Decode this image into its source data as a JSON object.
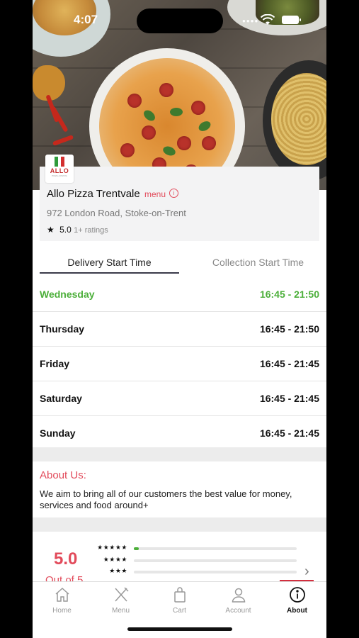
{
  "status_bar": {
    "time": "4:07"
  },
  "restaurant": {
    "logo_text": "ALLO",
    "logo_sub": "PIZZA & PASTA",
    "name": "Allo Pizza Trentvale",
    "menu_link": "menu",
    "info_glyph": "i",
    "address": "972 London Road, Stoke-on-Trent",
    "rating_star": "★",
    "rating": "5.0",
    "ratings_count": "1+ ratings"
  },
  "tabs": [
    {
      "label": "Delivery Start Time",
      "active": true
    },
    {
      "label": "Collection Start Time",
      "active": false
    }
  ],
  "hours": [
    {
      "day": "Wednesday",
      "time": "16:45 - 21:50",
      "today": true
    },
    {
      "day": "Thursday",
      "time": "16:45 - 21:50",
      "today": false
    },
    {
      "day": "Friday",
      "time": "16:45 - 21:45",
      "today": false
    },
    {
      "day": "Saturday",
      "time": "16:45 - 21:45",
      "today": false
    },
    {
      "day": "Sunday",
      "time": "16:45 - 21:45",
      "today": false
    }
  ],
  "about": {
    "title": "About Us:",
    "text": "We aim to bring all of our customers the best value for money, services and food around+"
  },
  "reviews": {
    "score": "5.0",
    "out_of": "Out of 5",
    "rows": [
      {
        "stars": "★★★★★",
        "fraction": 0.03
      },
      {
        "stars": "★★★★",
        "fraction": 0
      },
      {
        "stars": "★★★",
        "fraction": 0
      }
    ],
    "chevron": "›"
  },
  "nav": [
    {
      "label": "Home",
      "icon": "home-icon",
      "active": false
    },
    {
      "label": "Menu",
      "icon": "fork-knife-icon",
      "active": false
    },
    {
      "label": "Cart",
      "icon": "bag-icon",
      "active": false
    },
    {
      "label": "Account",
      "icon": "person-icon",
      "active": false
    },
    {
      "label": "About",
      "icon": "info-icon",
      "active": true
    }
  ],
  "colors": {
    "accent_red": "#e24b5b",
    "today_green": "#4caf3a",
    "tab_underline": "#3a3a4a"
  }
}
